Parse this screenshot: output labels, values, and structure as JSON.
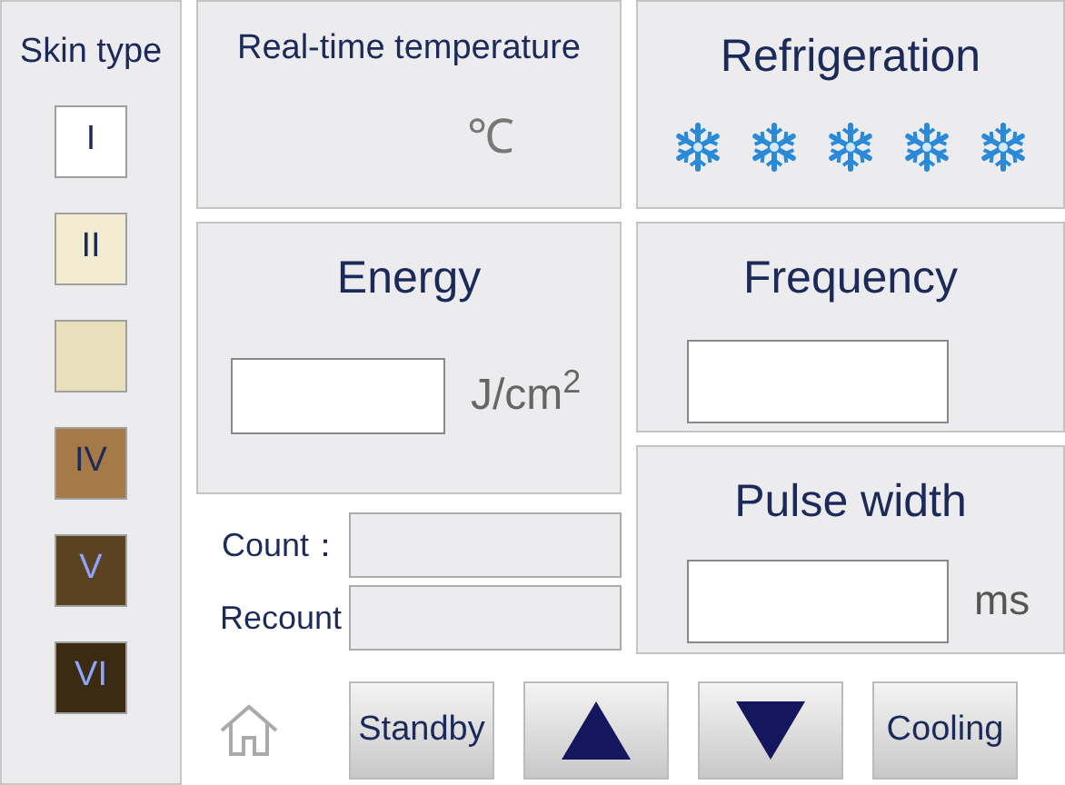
{
  "skin_type": {
    "title": "Skin type",
    "types": [
      {
        "label": "I",
        "color": "#ffffff"
      },
      {
        "label": "II",
        "color": "#f4ecd2"
      },
      {
        "color": "#eadfbb"
      },
      {
        "label": "IV",
        "color": "#a67a46"
      },
      {
        "label": "V",
        "color": "#5b4322"
      },
      {
        "label": "VI",
        "color": "#3b2b12"
      }
    ]
  },
  "temperature": {
    "title": "Real-time temperature",
    "unit": "℃"
  },
  "refrigeration": {
    "title": "Refrigeration",
    "indicators": [
      {
        "kind": "snowflake"
      },
      {
        "kind": "snowflake"
      },
      {
        "kind": "snowflake"
      },
      {
        "kind": "snowflake"
      },
      {
        "kind": "snowflake"
      }
    ]
  },
  "energy": {
    "title": "Energy",
    "unit": "J/cm$^{2}$"
  },
  "frequency": {
    "title": "Frequency"
  },
  "pulse_width": {
    "title": "Pulse width",
    "unit": "ms"
  },
  "counters": [
    {
      "label": "Count："
    },
    {
      "label": "Recount"
    }
  ],
  "buttons": [
    {
      "kind": "text",
      "label": "Standby"
    },
    {
      "kind": "up"
    },
    {
      "kind": "down"
    },
    {
      "kind": "text",
      "label": "Cooling"
    }
  ]
}
